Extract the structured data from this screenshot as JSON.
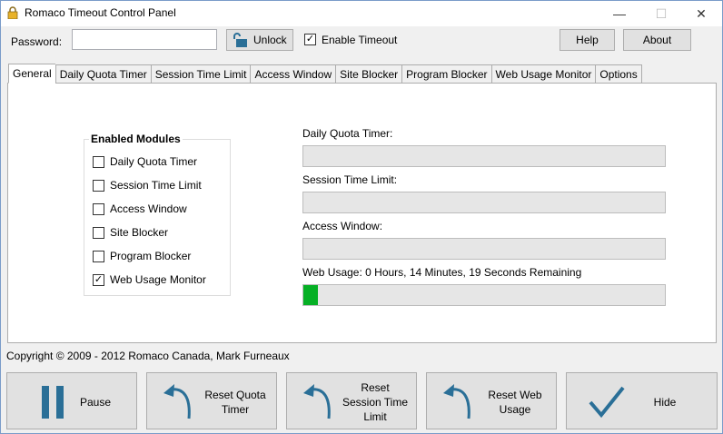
{
  "window": {
    "title": "Romaco Timeout Control Panel",
    "min_glyph": "—",
    "max_glyph": "☐",
    "close_glyph": "✕"
  },
  "toolbar": {
    "password_label": "Password:",
    "password_value": "",
    "unlock_label": "Unlock",
    "enable_timeout_label": "Enable Timeout",
    "enable_timeout_checked": true,
    "help_label": "Help",
    "about_label": "About"
  },
  "tabs": [
    {
      "label": "General",
      "active": true
    },
    {
      "label": "Daily Quota Timer",
      "active": false
    },
    {
      "label": "Session Time Limit",
      "active": false
    },
    {
      "label": "Access Window",
      "active": false
    },
    {
      "label": "Site Blocker",
      "active": false
    },
    {
      "label": "Program Blocker",
      "active": false
    },
    {
      "label": "Web Usage Monitor",
      "active": false
    },
    {
      "label": "Options",
      "active": false
    }
  ],
  "general": {
    "enabled_modules_title": "Enabled Modules",
    "modules": [
      {
        "label": "Daily Quota Timer",
        "checked": false
      },
      {
        "label": "Session Time Limit",
        "checked": false
      },
      {
        "label": "Access Window",
        "checked": false
      },
      {
        "label": "Site Blocker",
        "checked": false
      },
      {
        "label": "Program Blocker",
        "checked": false
      },
      {
        "label": "Web Usage Monitor",
        "checked": true
      }
    ],
    "status": [
      {
        "label": "Daily Quota Timer:",
        "progress": 0
      },
      {
        "label": "Session Time Limit:",
        "progress": 0
      },
      {
        "label": "Access Window:",
        "progress": 0
      },
      {
        "label": "Web Usage: 0 Hours, 14 Minutes, 19 Seconds Remaining",
        "progress": 0.04
      }
    ],
    "progress_color": "#06b025"
  },
  "footer": {
    "copyright": "Copyright © 2009 - 2012 Romaco Canada, Mark Furneaux",
    "buttons": {
      "pause": "Pause",
      "reset_quota_line1": "Reset Quota",
      "reset_quota_line2": "Timer",
      "reset_session_line1": "Reset",
      "reset_session_line2": "Session Time",
      "reset_session_line3": "Limit",
      "reset_web_line1": "Reset Web",
      "reset_web_line2": "Usage",
      "hide": "Hide"
    },
    "icon_color": "#2a6f97"
  },
  "check_glyph": "✓"
}
